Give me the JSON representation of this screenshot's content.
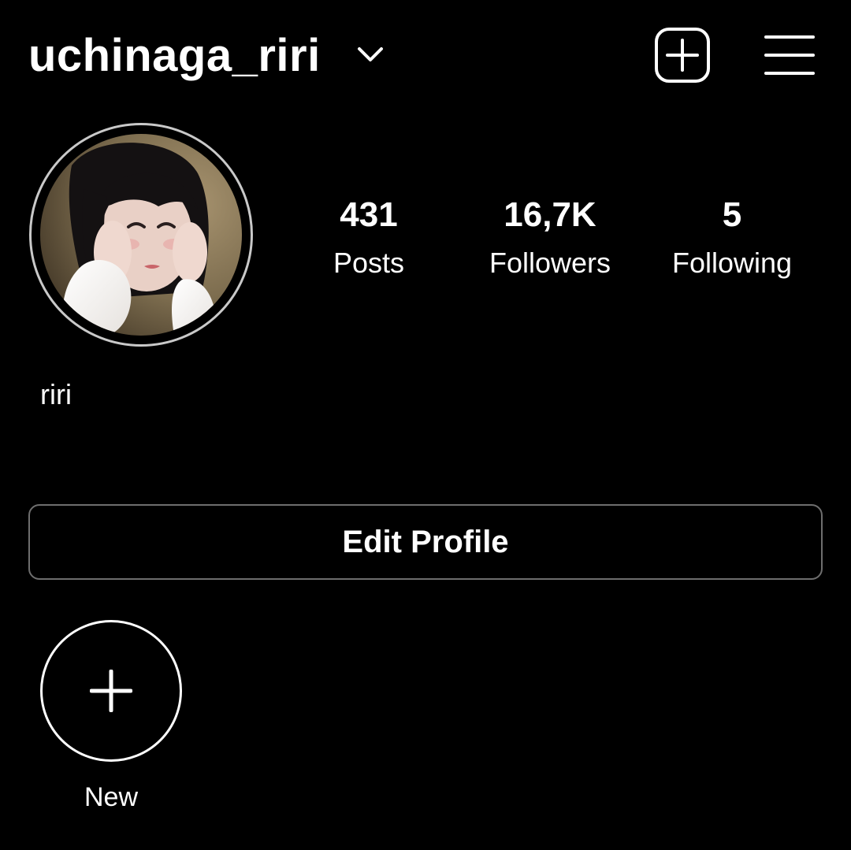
{
  "header": {
    "username": "uchinaga_riri",
    "account_switcher_icon": "chevron-down-icon",
    "new_post_icon": "add-square-icon",
    "menu_icon": "hamburger-menu-icon"
  },
  "profile": {
    "avatar_icon": "profile-photo",
    "display_name": "riri",
    "stats": [
      {
        "count": "431",
        "label": "Posts"
      },
      {
        "count": "16,7K",
        "label": "Followers"
      },
      {
        "count": "5",
        "label": "Following"
      }
    ],
    "edit_profile_label": "Edit Profile"
  },
  "highlights": {
    "new_label": "New",
    "new_icon": "plus-icon"
  },
  "colors": {
    "background": "#000000",
    "text": "#ffffff",
    "button_border": "#6e6e6e",
    "avatar_ring": "#c9c9c9"
  }
}
